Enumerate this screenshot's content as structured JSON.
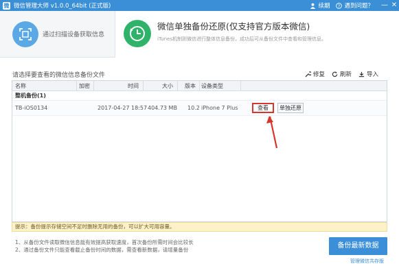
{
  "window": {
    "title": "微信管理大师 v1.0.0_64bit (正式版)",
    "feedback": "续期",
    "help": "遇到问题？",
    "min": "—",
    "close": "✕"
  },
  "tabs": [
    {
      "label": "通过扫描设备获取信息"
    },
    {
      "label": "微信单独备份还原(仅支持官方版本微信)",
      "sub": "iTunes机制则微信进行整体信息备份，成功后可从备份文件中查看和管理信息。"
    }
  ],
  "section_title": "请选择要查看的微信信息备份文件",
  "actions": {
    "repair": "修复",
    "refresh": "刷新",
    "import": "导入"
  },
  "table": {
    "columns": [
      "名称",
      "加密",
      "时间",
      "大小",
      "版本",
      "设备类型"
    ],
    "group": "整机备份(1)",
    "rows": [
      {
        "name": "TB-iOS0134",
        "encrypted": "",
        "time": "2017-04-27 18:57",
        "size": "404.73 MB",
        "version": "10.2",
        "device": "iPhone 7 Plus",
        "view": "查看",
        "single": "单独还原"
      }
    ]
  },
  "hint": "提示：备份提示存储空间不足时删除无用的备份，可以扩大可用容量。",
  "notes": [
    "1、从备份文件读取微信信息能有效提高获取速度，首次备份所需时间会比较长",
    "2、通过备份文件只能查看截止备份时间的数据，需查看新数据，请增量备份"
  ],
  "primary_button": "备份最新数据",
  "footer_link": "管理微信共存版",
  "colors": {
    "titlebar": "#3a8fd6",
    "accent_green": "#2fb36a",
    "accent_blue": "#5aa9e6",
    "highlight_red": "#d9332b"
  }
}
